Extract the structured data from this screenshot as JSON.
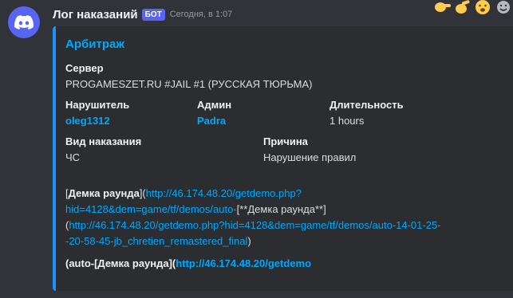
{
  "message": {
    "username": "Лог наказаний",
    "bot_tag": "БОТ",
    "timestamp": "Сегодня, в 1:07"
  },
  "reactions": [
    "hand-point-right-icon",
    "hand-point-right-icon",
    "smiley-face-icon",
    "emoji-add-icon"
  ],
  "embed": {
    "accent_color": "#1e90ff",
    "title": "Арбитраж",
    "server": {
      "name": "Сервер",
      "value": "PROGAMESZET.RU #JAIL #1 (РУССКАЯ ТЮРЬМА)"
    },
    "offender": {
      "name": "Нарушитель",
      "value": "oleg1312"
    },
    "admin": {
      "name": "Админ",
      "value": "Padra"
    },
    "duration": {
      "name": "Длительность",
      "value": "1 hours"
    },
    "punishment": {
      "name": "Вид наказания",
      "value": "ЧС"
    },
    "reason": {
      "name": "Причина",
      "value": "Нарушение правил"
    },
    "description": {
      "p1_open": "[",
      "p1_bold": "Демка раунда",
      "p1_mid": "](",
      "p1_link1": "http://46.174.48.20/getdemo.php?hid=4128&dem=game/tf/demos/auto-",
      "p1_text2": "[**Демка раунда**](",
      "p1_link2": "http://46.174.48.20/getdemo.php?hid=4128&dem=game/tf/demos/auto-14-01-25--20-58-45-jb_chretien_remastered_final",
      "p1_close": ")",
      "p2_bold1": "(auto-[Демка раунда](",
      "p2_link": "http://46.174.48.20/getdemo"
    }
  }
}
